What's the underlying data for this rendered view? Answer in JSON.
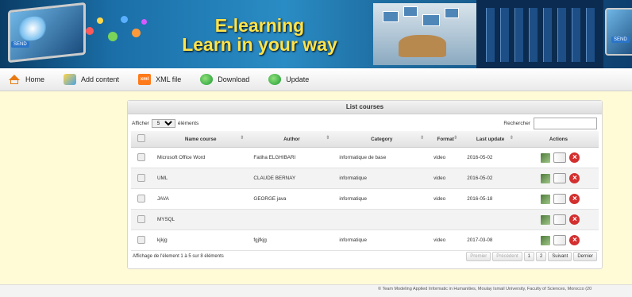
{
  "banner": {
    "title_line1": "E-learning",
    "title_line2": "Learn in your way",
    "send_tag": "SEND",
    "send_tag_right": "SEND"
  },
  "nav": {
    "items": [
      {
        "label": "Home",
        "icon": "home-icon"
      },
      {
        "label": "Add content",
        "icon": "add-content-icon"
      },
      {
        "label": "XML file",
        "icon": "xml-file-icon"
      },
      {
        "label": "Download",
        "icon": "download-icon"
      },
      {
        "label": "Update",
        "icon": "update-icon"
      }
    ]
  },
  "panel": {
    "title": "List courses",
    "show_label": "Afficher",
    "show_value": "5",
    "show_suffix": "éléments",
    "search_label": "Rechercher",
    "search_value": ""
  },
  "table": {
    "headers": [
      "Name course",
      "Author",
      "Category",
      "Format",
      "Last update",
      "Actions"
    ],
    "rows": [
      {
        "name": "Microsoft Office Word",
        "author": "Fatiha ELGHIBARI",
        "category": "informatique de base",
        "format": "video",
        "updated": "2016-05-02"
      },
      {
        "name": "UML",
        "author": "CLAUDE BERNAY",
        "category": "informatique",
        "format": "video",
        "updated": "2016-05-02"
      },
      {
        "name": "JAVA",
        "author": "GEORGE java",
        "category": "informatique",
        "format": "video",
        "updated": "2016-05-18"
      },
      {
        "name": "MYSQL",
        "author": "",
        "category": "",
        "format": "",
        "updated": ""
      },
      {
        "name": "kjkjg",
        "author": "fgjfkjg",
        "category": "informatique",
        "format": "video",
        "updated": "2017-03-08"
      }
    ]
  },
  "footer": {
    "info": "Affichage de l'élement 1 à 5 sur 8 éléments",
    "pager": {
      "first": "Premier",
      "previous": "Précédent",
      "page1": "1",
      "page2": "2",
      "next": "Suivant",
      "last": "Dernier"
    },
    "copyright": "© Team Modeling Applied Informatic in Humanities, Moulay Ismail University, Faculty of Sciences, Morocco (20"
  },
  "colors": {
    "page_bg": "#fffbd6",
    "banner_title": "#ffe34a",
    "delete_red": "#d32f2f"
  }
}
